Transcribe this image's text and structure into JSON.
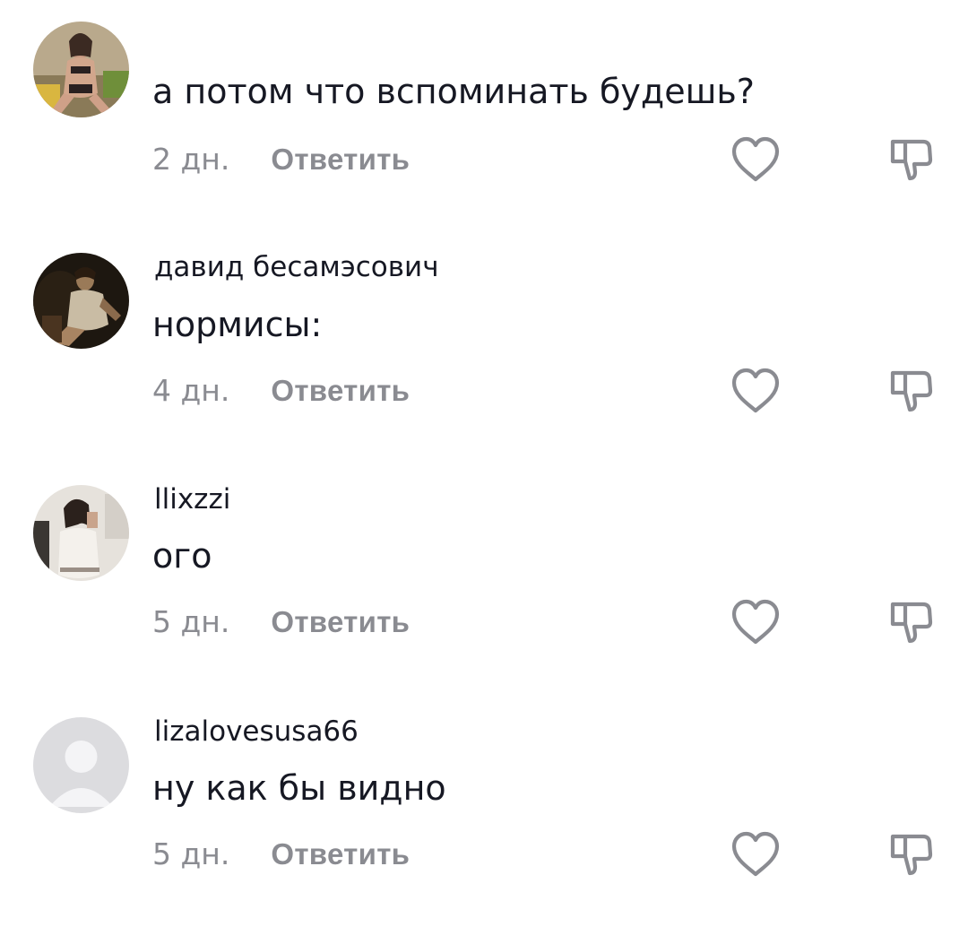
{
  "comments": [
    {
      "username": "",
      "text": "а потом что вспоминать будешь?",
      "date": "2 дн.",
      "reply_label": "Ответить",
      "avatar": "photo-woman"
    },
    {
      "username": "давид бесамэсович",
      "text": "нормисы:",
      "date": "4 дн.",
      "reply_label": "Ответить",
      "avatar": "painting-dark"
    },
    {
      "username": "llixzzi",
      "text": "ого",
      "date": "5 дн.",
      "reply_label": "Ответить",
      "avatar": "photo-selfie"
    },
    {
      "username": "lizalovesusa66",
      "text": "ну как бы видно",
      "date": "5 дн.",
      "reply_label": "Ответить",
      "avatar": "default-avatar"
    }
  ],
  "icons": {
    "like": "heart-outline-icon",
    "dislike": "thumbs-down-outline-icon"
  },
  "colors": {
    "text": "#161823",
    "secondary": "#8a8b91",
    "icon": "#8a8b91"
  }
}
